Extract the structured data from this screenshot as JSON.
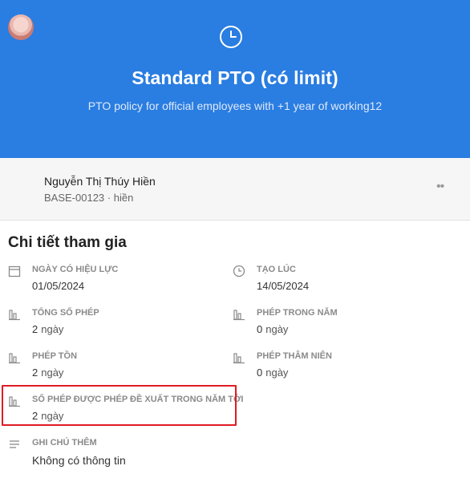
{
  "header": {
    "title": "Standard PTO (có limit)",
    "subtitle": "PTO policy for official employees with +1 year of working12",
    "icon": "clock-icon",
    "color": "#2a7de1"
  },
  "user": {
    "name": "Nguyễn Thị Thúy Hiền",
    "sub": "BASE-00123 · hiền",
    "more": "••"
  },
  "section": {
    "title": "Chi tiết tham gia",
    "fields": [
      {
        "icon": "calendar-icon",
        "label": "NGÀY CÓ HIỆU LỰC",
        "value": "01/05/2024",
        "unit": ""
      },
      {
        "icon": "clock-icon",
        "label": "TẠO LÚC",
        "value": "14/05/2024",
        "unit": ""
      },
      {
        "icon": "bar-chart-icon",
        "label": "TỔNG SỐ PHÉP",
        "value": "2",
        "unit": "ngày"
      },
      {
        "icon": "bar-chart-icon",
        "label": "PHÉP TRONG NĂM",
        "value": "0",
        "unit": "ngày"
      },
      {
        "icon": "bar-chart-icon",
        "label": "PHÉP TỒN",
        "value": "2",
        "unit": "ngày"
      },
      {
        "icon": "bar-chart-icon",
        "label": "PHÉP THÂM NIÊN",
        "value": "0",
        "unit": "ngày"
      },
      {
        "icon": "bar-chart-icon",
        "label": "SỐ PHÉP ĐƯỢC PHÉP ĐỀ XUẤT TRONG NĂM TỚI",
        "value": "2",
        "unit": "ngày"
      },
      {
        "icon": "notes-icon",
        "label": "GHI CHÚ THÊM",
        "value": "Không có thông tin",
        "unit": ""
      }
    ]
  },
  "colors": {
    "highlight": "#e01b24"
  }
}
